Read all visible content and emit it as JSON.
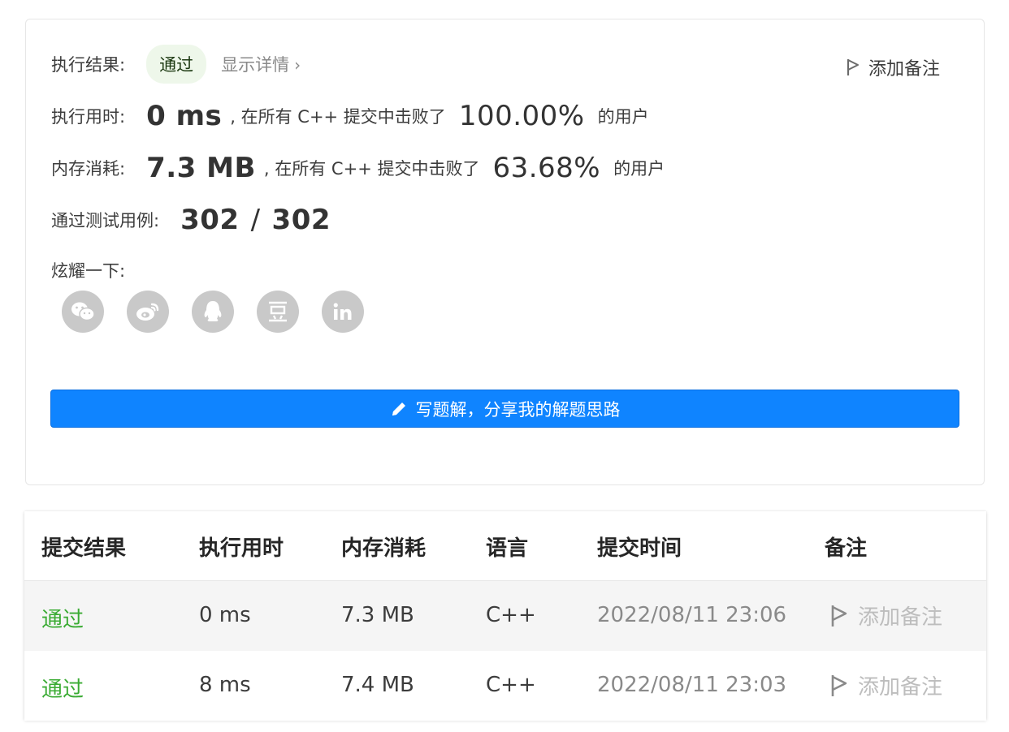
{
  "result": {
    "label": "执行结果:",
    "status": "通过",
    "details_link": "显示详情",
    "add_note": "添加备注"
  },
  "runtime": {
    "label": "执行用时:",
    "value": "0 ms",
    "mid_text": ", 在所有 C++ 提交中击败了",
    "percent": "100.00%",
    "suffix": "的用户"
  },
  "memory": {
    "label": "内存消耗:",
    "value": "7.3 MB",
    "mid_text": ", 在所有 C++ 提交中击败了",
    "percent": "63.68%",
    "suffix": "的用户"
  },
  "tests": {
    "label": "通过测试用例:",
    "passed": "302",
    "separator": "/",
    "total": "302"
  },
  "share": {
    "label": "炫耀一下:",
    "icons": [
      "wechat-icon",
      "weibo-icon",
      "qq-icon",
      "douban-icon",
      "linkedin-icon"
    ],
    "icon_color": "#c9c9c9"
  },
  "write_solution_button": "写题解，分享我的解题思路",
  "accent_color": "#0f84ff",
  "submissions": {
    "headers": [
      "提交结果",
      "执行用时",
      "内存消耗",
      "语言",
      "提交时间",
      "备注"
    ],
    "rows": [
      {
        "status": "通过",
        "runtime": "0 ms",
        "memory": "7.3 MB",
        "language": "C++",
        "time": "2022/08/11 23:06",
        "note": "添加备注"
      },
      {
        "status": "通过",
        "runtime": "8 ms",
        "memory": "7.4 MB",
        "language": "C++",
        "time": "2022/08/11 23:03",
        "note": "添加备注"
      }
    ],
    "status_color": "#3aab33"
  }
}
